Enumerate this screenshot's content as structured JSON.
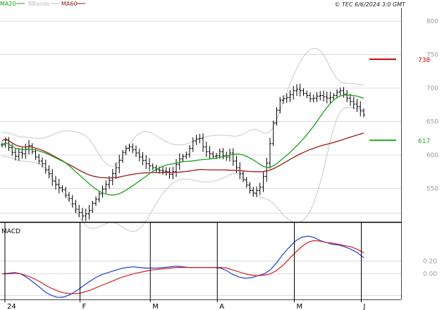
{
  "header": {
    "copyright": "© TEC 6/6/2024 3:0 GMT",
    "legend": [
      {
        "label": "MA20",
        "color": "#1a9a1a"
      },
      {
        "label": "BBands",
        "color": "#bbbbbb"
      },
      {
        "label": "MA60",
        "color": "#8b1a1a"
      }
    ]
  },
  "chart_data": [
    {
      "type": "ohlc",
      "panel": "price",
      "ylim": [
        500,
        820
      ],
      "yticks": [
        "550",
        "600",
        "650",
        "700",
        "750",
        "800"
      ],
      "ytick_values": [
        550,
        600,
        650,
        700,
        750,
        800
      ],
      "x_labels": [
        "24",
        "F",
        "M",
        "A",
        "M",
        "J"
      ],
      "x_label_index": [
        0,
        22,
        43,
        63,
        86,
        106
      ],
      "n_bars": 109,
      "levels": [
        {
          "label": "738",
          "value": 743,
          "color": "#cc0000"
        },
        {
          "label": "617",
          "value": 622,
          "color": "#22aa22"
        }
      ],
      "close": [
        615,
        622,
        611,
        604,
        598,
        604,
        602,
        609,
        614,
        605,
        597,
        591,
        587,
        578,
        572,
        561,
        556,
        551,
        548,
        540,
        535,
        527,
        519,
        514,
        509,
        512,
        517,
        528,
        534,
        542,
        549,
        556,
        562,
        572,
        581,
        592,
        604,
        610,
        612,
        608,
        603,
        597,
        592,
        587,
        584,
        581,
        578,
        577,
        576,
        575,
        571,
        575,
        586,
        594,
        598,
        601,
        610,
        621,
        624,
        625,
        612,
        605,
        602,
        598,
        599,
        605,
        599,
        597,
        603,
        591,
        581,
        572,
        563,
        555,
        547,
        543,
        547,
        552,
        568,
        588,
        617,
        648,
        667,
        682,
        684,
        686,
        690,
        696,
        698,
        696,
        692,
        689,
        684,
        685,
        688,
        689,
        687,
        685,
        686,
        689,
        694,
        696,
        691,
        685,
        680,
        676,
        672,
        666,
        660
      ],
      "ma20": [
        614,
        612,
        610,
        606,
        601,
        597,
        592,
        586,
        581,
        575,
        570,
        566,
        562,
        559,
        558,
        557,
        557,
        557,
        558,
        559,
        561,
        564,
        567,
        571,
        575,
        579,
        583,
        586,
        590,
        593,
        596,
        597,
        599,
        601,
        603,
        605,
        606,
        607,
        607,
        608,
        608,
        608,
        609,
        609,
        609,
        609,
        609,
        610,
        611,
        612,
        614,
        617,
        621,
        625,
        629,
        633,
        638,
        643,
        648,
        654,
        659,
        665,
        669,
        674,
        677,
        680,
        682,
        683,
        683,
        683,
        683
      ],
      "ma20_start": 38,
      "ma60": [
        602,
        600,
        598,
        596,
        594,
        592,
        590,
        588,
        586,
        584,
        582,
        581,
        579,
        578,
        577,
        576,
        575,
        575,
        574,
        574,
        573,
        573,
        573,
        573,
        572,
        572,
        572,
        572,
        573,
        573,
        573,
        574,
        574,
        575,
        575,
        575,
        576,
        576,
        577,
        578,
        579,
        580,
        581,
        583,
        585,
        587,
        590,
        593,
        596,
        599,
        602,
        605,
        608,
        611,
        613,
        615,
        617,
        619,
        622,
        624,
        627
      ],
      "ma60_start": 48
    },
    {
      "type": "line",
      "panel": "macd",
      "title": "MACD",
      "ylim": [
        -4,
        8
      ],
      "yticks": [
        "0.00",
        "0.20"
      ],
      "ytick_values": [
        0,
        2
      ],
      "series": [
        {
          "color": "#1f3fcf",
          "values": [
            0.0,
            0.1,
            0.2,
            0.0,
            -0.6,
            -1.3,
            -2.1,
            -2.9,
            -3.4,
            -3.7,
            -3.6,
            -3.2,
            -2.6,
            -1.9,
            -1.2,
            -0.6,
            -0.1,
            0.2,
            0.5,
            0.8,
            1.0,
            1.1,
            1.0,
            0.9,
            0.9,
            0.9,
            1.0,
            1.1,
            1.2,
            1.1,
            1.0,
            1.0,
            1.0,
            1.0,
            1.0,
            0.9,
            0.5,
            -0.1,
            -0.5,
            -0.7,
            -0.6,
            -0.3,
            0.0,
            0.6,
            1.7,
            3.0,
            4.1,
            5.1,
            5.7,
            5.9,
            5.7,
            5.2,
            4.9,
            4.6,
            4.5,
            4.2,
            3.8,
            3.3,
            2.5
          ]
        },
        {
          "color": "#d42020",
          "values": [
            0.0,
            0.0,
            0.1,
            0.0,
            -0.3,
            -0.7,
            -1.2,
            -1.8,
            -2.3,
            -2.7,
            -3.0,
            -3.1,
            -3.1,
            -2.9,
            -2.6,
            -2.2,
            -1.8,
            -1.4,
            -1.0,
            -0.6,
            -0.3,
            0.0,
            0.2,
            0.4,
            0.6,
            0.7,
            0.8,
            0.9,
            1.0,
            1.0,
            1.0,
            1.0,
            1.0,
            1.0,
            1.0,
            1.0,
            0.9,
            0.6,
            0.3,
            0.0,
            -0.2,
            -0.3,
            -0.2,
            0.0,
            0.5,
            1.3,
            2.3,
            3.3,
            4.2,
            4.9,
            5.2,
            5.1,
            4.9,
            4.8,
            4.6,
            4.4,
            4.2,
            3.8,
            3.3
          ]
        }
      ]
    }
  ]
}
